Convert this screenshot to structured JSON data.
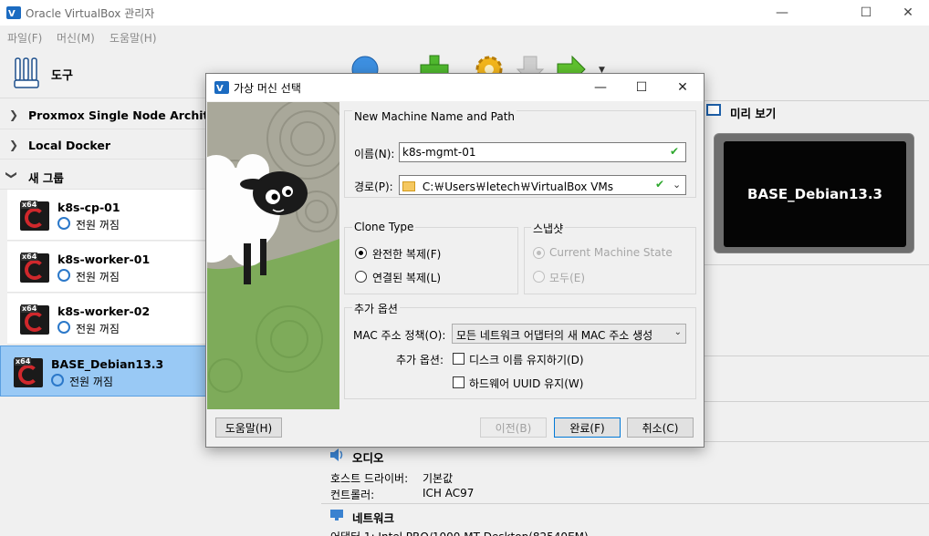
{
  "main_window": {
    "title": "Oracle VirtualBox 관리자",
    "menu": [
      "파일(F)",
      "머신(M)",
      "도움말(H)"
    ],
    "tools_label": "도구"
  },
  "machine_list": {
    "groups": [
      {
        "label": "Proxmox Single Node Architecture",
        "expanded": false
      },
      {
        "label": "Local Docker",
        "expanded": false
      },
      {
        "label": "새 그룹",
        "expanded": true
      }
    ],
    "vms": [
      {
        "name": "k8s-cp-01",
        "state": "전원 꺼짐",
        "arch": "x64"
      },
      {
        "name": "k8s-worker-01",
        "state": "전원 꺼짐",
        "arch": "x64"
      },
      {
        "name": "k8s-worker-02",
        "state": "전원 꺼짐",
        "arch": "x64"
      },
      {
        "name": "BASE_Debian13.3",
        "state": "전원 꺼짐",
        "arch": "x64",
        "selected": true
      }
    ]
  },
  "details": {
    "preview_title": "미리 보기",
    "preview_vm_name": "BASE_Debian13.3",
    "audio": {
      "title": "오디오",
      "host_driver_label": "호스트 드라이버:",
      "host_driver_value": "기본값",
      "controller_label": "컨트롤러:",
      "controller_value": "ICH AC97"
    },
    "network": {
      "title": "네트워크",
      "adapter1": "어댑터 1:  Intel PRO/1000 MT Desktop(82540EM)"
    }
  },
  "dialog": {
    "title": "가상 머신 선택",
    "name_path_group": "New Machine Name and Path",
    "name_label": "이름(N):",
    "name_value": "k8s-mgmt-01",
    "path_label": "경로(P):",
    "path_value": "C:￦Users￦letech￦VirtualBox VMs",
    "clone_type_group": "Clone Type",
    "clone_full": "완전한 복제(F)",
    "clone_linked": "연결된 복제(L)",
    "snapshot_group": "스냅샷",
    "snapshot_current": "Current Machine State",
    "snapshot_all": "모두(E)",
    "extra_group": "추가 옵션",
    "mac_label": "MAC 주소 정책(O):",
    "mac_value": "모든 네트워크 어댑터의 새 MAC 주소 생성",
    "extra_label": "추가 옵션:",
    "keep_disk_names": "디스크 이름 유지하기(D)",
    "keep_hw_uuid": "하드웨어 UUID 유지(W)",
    "buttons": {
      "help": "도움말(H)",
      "back": "이전(B)",
      "finish": "완료(F)",
      "cancel": "취소(C)"
    }
  }
}
